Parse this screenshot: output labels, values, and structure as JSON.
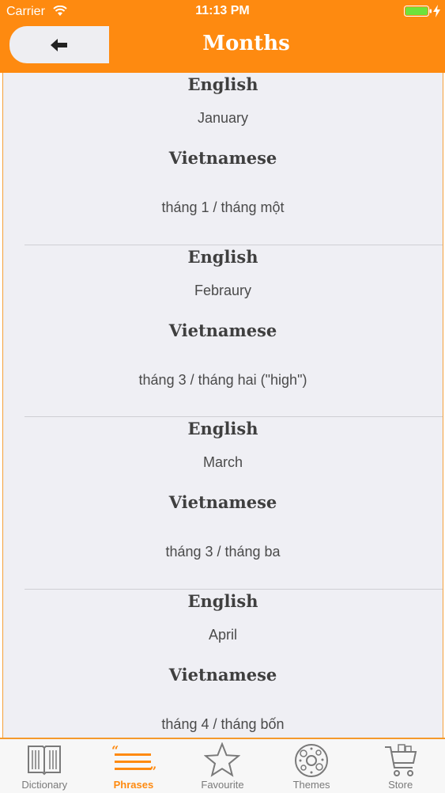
{
  "status": {
    "carrier": "Carrier",
    "time": "11:13 PM"
  },
  "nav": {
    "title": "Months"
  },
  "entries": [
    {
      "en_label": "English",
      "en_text": "January",
      "vi_label": "Vietnamese",
      "vi_text": "tháng 1 / tháng một"
    },
    {
      "en_label": "English",
      "en_text": "Febraury",
      "vi_label": "Vietnamese",
      "vi_text": "tháng 3 / tháng hai (\"high\")"
    },
    {
      "en_label": "English",
      "en_text": "March",
      "vi_label": "Vietnamese",
      "vi_text": "tháng 3 / tháng ba"
    },
    {
      "en_label": "English",
      "en_text": "April",
      "vi_label": "Vietnamese",
      "vi_text": "tháng 4 / tháng bốn"
    }
  ],
  "tabs": [
    {
      "label": "Dictionary",
      "icon": "book-icon"
    },
    {
      "label": "Phrases",
      "icon": "phrases-icon",
      "active": true
    },
    {
      "label": "Favourite",
      "icon": "star-icon"
    },
    {
      "label": "Themes",
      "icon": "themes-icon"
    },
    {
      "label": "Store",
      "icon": "cart-icon"
    }
  ],
  "colors": {
    "accent": "#fe8a10",
    "background": "#efeff4",
    "tab_inactive": "#7a7a7a"
  }
}
